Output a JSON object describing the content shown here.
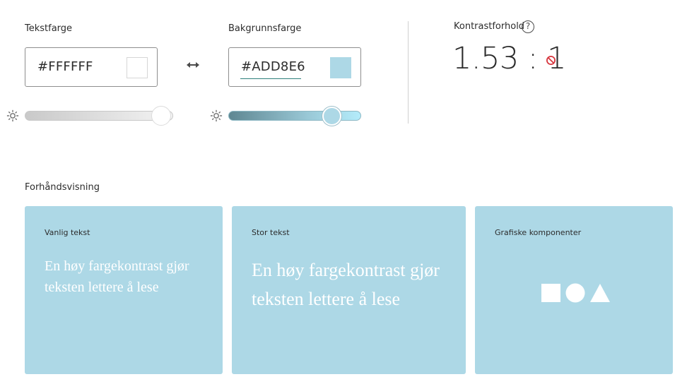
{
  "text_color": {
    "label": "Tekstfarge",
    "value": "#FFFFFF",
    "swatch": "#ffffff",
    "brightness_level": 0.93
  },
  "background_color": {
    "label": "Bakgrunnsfarge",
    "value": "#ADD8E6",
    "swatch": "#add8e6",
    "brightness_level": 0.77
  },
  "contrast": {
    "label": "Kontrastforhold",
    "help_symbol": "?",
    "ratio": "1.53 : 1",
    "status_icon": "fail-icon"
  },
  "preview": {
    "heading": "Forhåndsvisning",
    "cards": [
      {
        "title": "Vanlig tekst",
        "text": "En høy fargekontrast gjør teksten lettere å lese"
      },
      {
        "title": "Stor tekst",
        "text": "En høy fargekontrast gjør teksten lettere å lese"
      },
      {
        "title": "Grafiske komponenter",
        "shapes": [
          "square",
          "circle",
          "triangle"
        ]
      }
    ]
  },
  "icons": [
    "swap-icon",
    "sun-icon",
    "help-icon",
    "fail-icon"
  ],
  "colors": {
    "preview_bg": "#add8e6",
    "preview_fg": "#ffffff",
    "fail": "#d7373f",
    "underline": "#2d7f7a"
  }
}
